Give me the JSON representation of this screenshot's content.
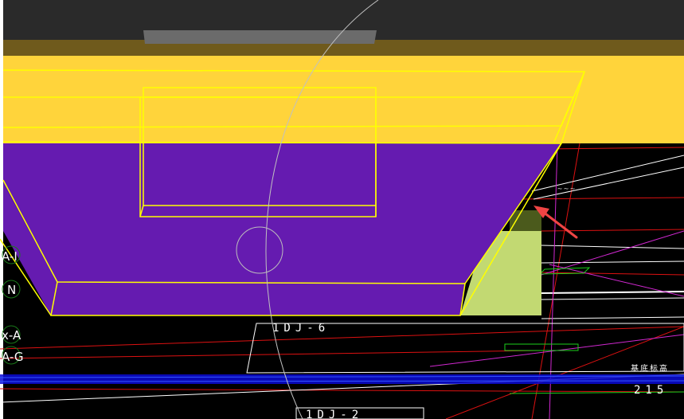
{
  "viewport": {
    "colors": {
      "background": "#000000",
      "top_band": "#2a2a2a",
      "edge_band": "#6f5a1c",
      "yellow_face": "#ffd43b",
      "purple_face": "#651bb0",
      "outline": "#ffff00",
      "green_face": "#c2d972",
      "arrow": "#ef4444"
    },
    "axis_labels": {
      "a_i": "A-I",
      "n": "N",
      "x_a": "x-A",
      "a_g": "A-G"
    },
    "cad_texts": {
      "beam_1": "1DJ-6",
      "beam_2": "1DJ-2",
      "note": "基底标高",
      "dim": "215"
    }
  }
}
